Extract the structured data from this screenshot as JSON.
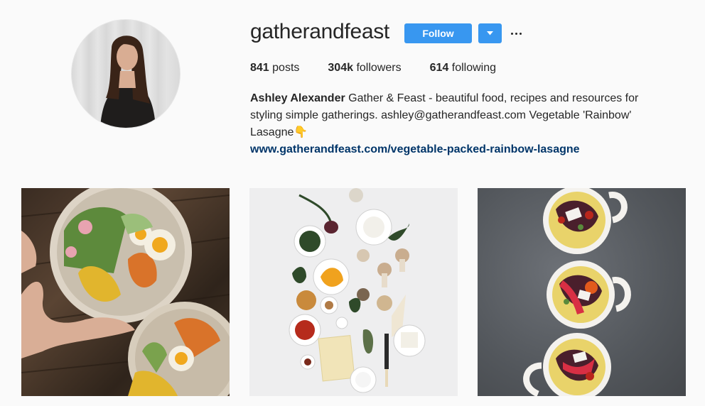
{
  "profile": {
    "username": "gatherandfeast",
    "follow_label": "Follow",
    "stats": {
      "posts_count": "841",
      "posts_label": "posts",
      "followers_count": "304k",
      "followers_label": "followers",
      "following_count": "614",
      "following_label": "following"
    },
    "bio": {
      "full_name": "Ashley Alexander",
      "text": "Gather & Feast - beautiful food, recipes and resources for styling simple gatherings. ashley@gatherandfeast.com Vegetable 'Rainbow' Lasagne",
      "emoji": "👇",
      "link": "www.gatherandfeast.com/vegetable-packed-rainbow-lasagne"
    }
  },
  "icons": {
    "dropdown": "chevron-down-icon",
    "more": "more-options-icon"
  },
  "colors": {
    "follow_blue": "#3897f0",
    "link_blue": "#003569",
    "text": "#262626",
    "background": "#fafafa"
  }
}
